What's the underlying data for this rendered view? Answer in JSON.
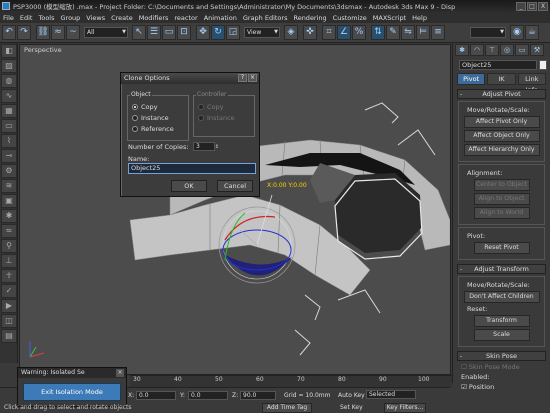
{
  "window": {
    "title": "PSP3000 (模型缩放) .max   - Project Folder: C:\\Documents and Settings\\Administrator\\My Documents\\3dsmax   - Autodesk 3ds Max 9   - Disp",
    "buttons": [
      "_",
      "□",
      "X"
    ]
  },
  "menu": [
    "File",
    "Edit",
    "Tools",
    "Group",
    "Views",
    "Create",
    "Modifiers",
    "reactor",
    "Animation",
    "Graph Editors",
    "Rendering",
    "Customize",
    "MAXScript",
    "Help"
  ],
  "toolbar": {
    "selection_filter": "All",
    "ref_coord": "View"
  },
  "viewport": {
    "label": "Perspective",
    "coord_readout": "X:0.00 Y:0.00"
  },
  "clone_dialog": {
    "title": "Clone Options",
    "object_group": "Object",
    "options": [
      "Copy",
      "Instance",
      "Reference"
    ],
    "selected_option": "Copy",
    "controller_group": "Controller",
    "controller_options": [
      "Copy",
      "Instance"
    ],
    "num_copies_label": "Number of Copies:",
    "num_copies": "3",
    "name_label": "Name:",
    "name_value": "Object25",
    "ok": "OK",
    "cancel": "Cancel"
  },
  "command_panel": {
    "object_name": "Object25",
    "tabs": [
      "Pivot",
      "IK",
      "Link Info"
    ],
    "active_tab": "Pivot",
    "adjust_pivot": {
      "title": "Adjust Pivot",
      "move_label": "Move/Rotate/Scale:",
      "buttons": [
        "Affect Pivot Only",
        "Affect Object Only",
        "Affect Hierarchy Only"
      ]
    },
    "alignment": {
      "label": "Alignment:",
      "buttons": [
        "Center to Object",
        "Align to Object",
        "Align to World"
      ]
    },
    "pivot": {
      "label": "Pivot:",
      "reset": "Reset Pivot"
    },
    "adjust_transform": {
      "title": "Adjust Transform",
      "move_label": "Move/Rotate/Scale:",
      "dont_affect": "Don't Affect Children",
      "reset_label": "Reset:",
      "transform": "Transform",
      "scale": "Scale"
    },
    "skin_pose": {
      "title": "Skin Pose",
      "mode": "Skin Pose Mode",
      "enabled": "Enabled:",
      "position": "Position"
    }
  },
  "timeline": {
    "ticks": [
      "30",
      "40",
      "50",
      "60",
      "70",
      "80",
      "90",
      "100"
    ]
  },
  "status": {
    "x_label": "X:",
    "x_value": "0.0",
    "y_label": "Y:",
    "y_value": "0.0",
    "z_label": "Z:",
    "z_value": "90.0",
    "grid": "Grid = 10.0mm",
    "auto_key": "Auto Key",
    "set_key": "Set Key",
    "selected": "Selected",
    "key_filters": "Key Filters...",
    "add_time_tag": "Add Time Tag",
    "message": "Click and drag to select and rotate objects"
  },
  "isolation": {
    "title": "Warning: Isolated Se",
    "button": "Exit Isolation Mode"
  }
}
